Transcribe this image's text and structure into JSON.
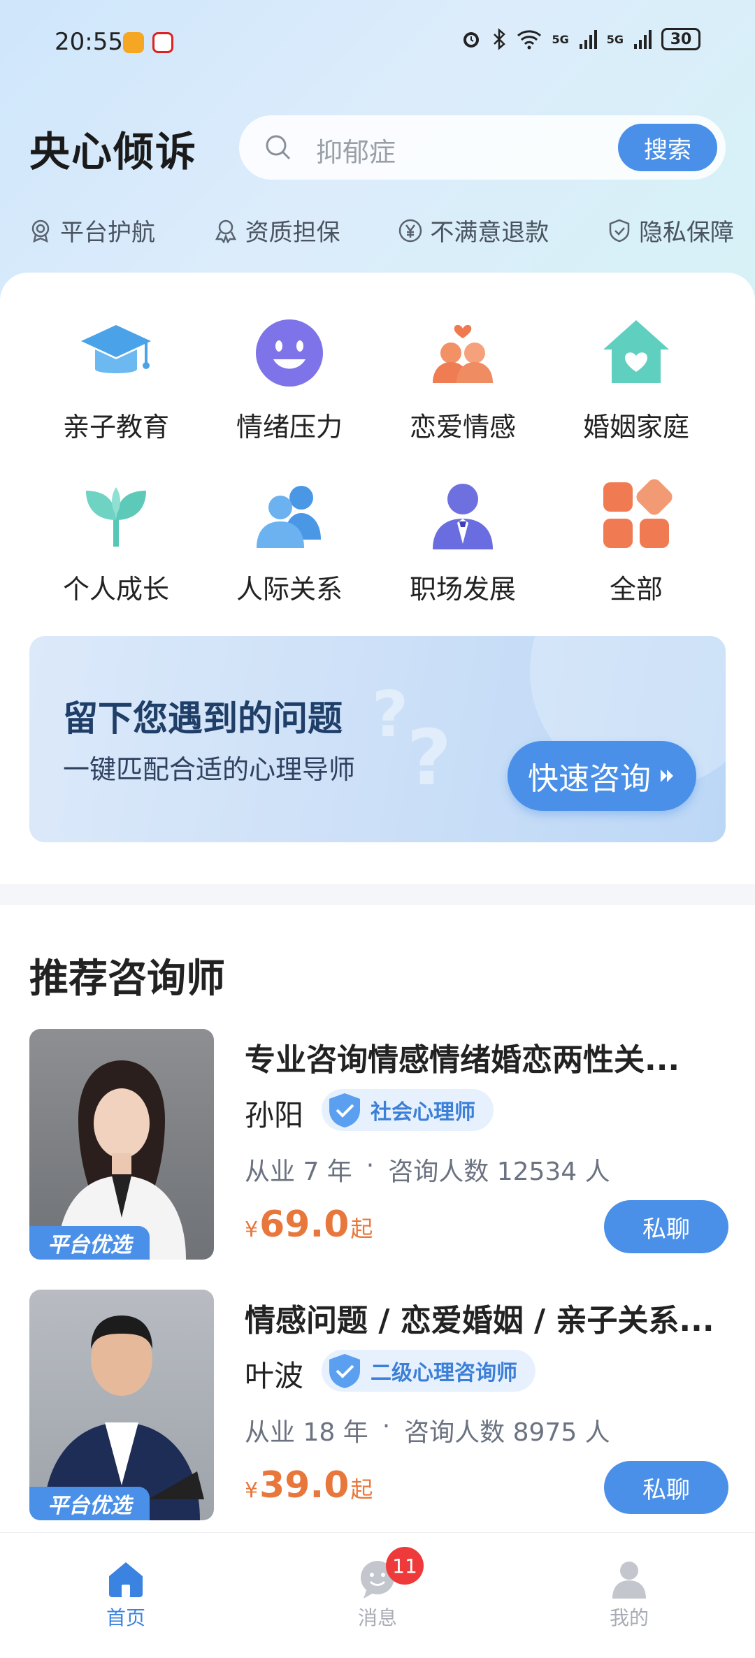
{
  "status_bar": {
    "time": "20:55",
    "network": "5G",
    "network2": "5G",
    "battery": "30"
  },
  "header": {
    "app_title": "央心倾诉",
    "search_placeholder": "抑郁症",
    "search_button": "搜索"
  },
  "guarantees": [
    {
      "label": "平台护航",
      "icon": "badge-icon"
    },
    {
      "label": "资质担保",
      "icon": "certificate-icon"
    },
    {
      "label": "不满意退款",
      "icon": "yen-icon"
    },
    {
      "label": "隐私保障",
      "icon": "shield-icon"
    }
  ],
  "categories": [
    {
      "label": "亲子教育",
      "icon": "graduation-cap-icon"
    },
    {
      "label": "情绪压力",
      "icon": "smiley-icon"
    },
    {
      "label": "恋爱情感",
      "icon": "couple-heart-icon"
    },
    {
      "label": "婚姻家庭",
      "icon": "house-heart-icon"
    },
    {
      "label": "个人成长",
      "icon": "sprout-icon"
    },
    {
      "label": "人际关系",
      "icon": "people-icon"
    },
    {
      "label": "职场发展",
      "icon": "businessman-icon"
    },
    {
      "label": "全部",
      "icon": "grid-icon"
    }
  ],
  "banner": {
    "title": "留下您遇到的问题",
    "subtitle": "一键匹配合适的心理导师",
    "button": "快速咨询"
  },
  "recommend": {
    "title": "推荐咨询师",
    "photo_badge": "平台优选",
    "chat_label": "私聊",
    "counselors": [
      {
        "headline": "专业咨询情感情绪婚恋两性关...",
        "name": "孙阳",
        "cert": "社会心理师",
        "years": "从业 7 年",
        "clients": "咨询人数 12534 人",
        "price_symbol": "¥",
        "price": "69.0",
        "price_suffix": "起"
      },
      {
        "headline": "情感问题 / 恋爱婚姻 / 亲子关系...",
        "name": "叶波",
        "cert": "二级心理咨询师",
        "years": "从业 18 年",
        "clients": "咨询人数 8975 人",
        "price_symbol": "¥",
        "price": "39.0",
        "price_suffix": "起"
      }
    ]
  },
  "bottom_nav": {
    "items": [
      {
        "label": "首页",
        "icon": "home-icon",
        "active": true
      },
      {
        "label": "消息",
        "icon": "message-icon",
        "badge": "11"
      },
      {
        "label": "我的",
        "icon": "profile-icon"
      }
    ]
  },
  "colors": {
    "accent": "#4a90e8",
    "price": "#e8773c",
    "badge": "#ee3a3a"
  }
}
